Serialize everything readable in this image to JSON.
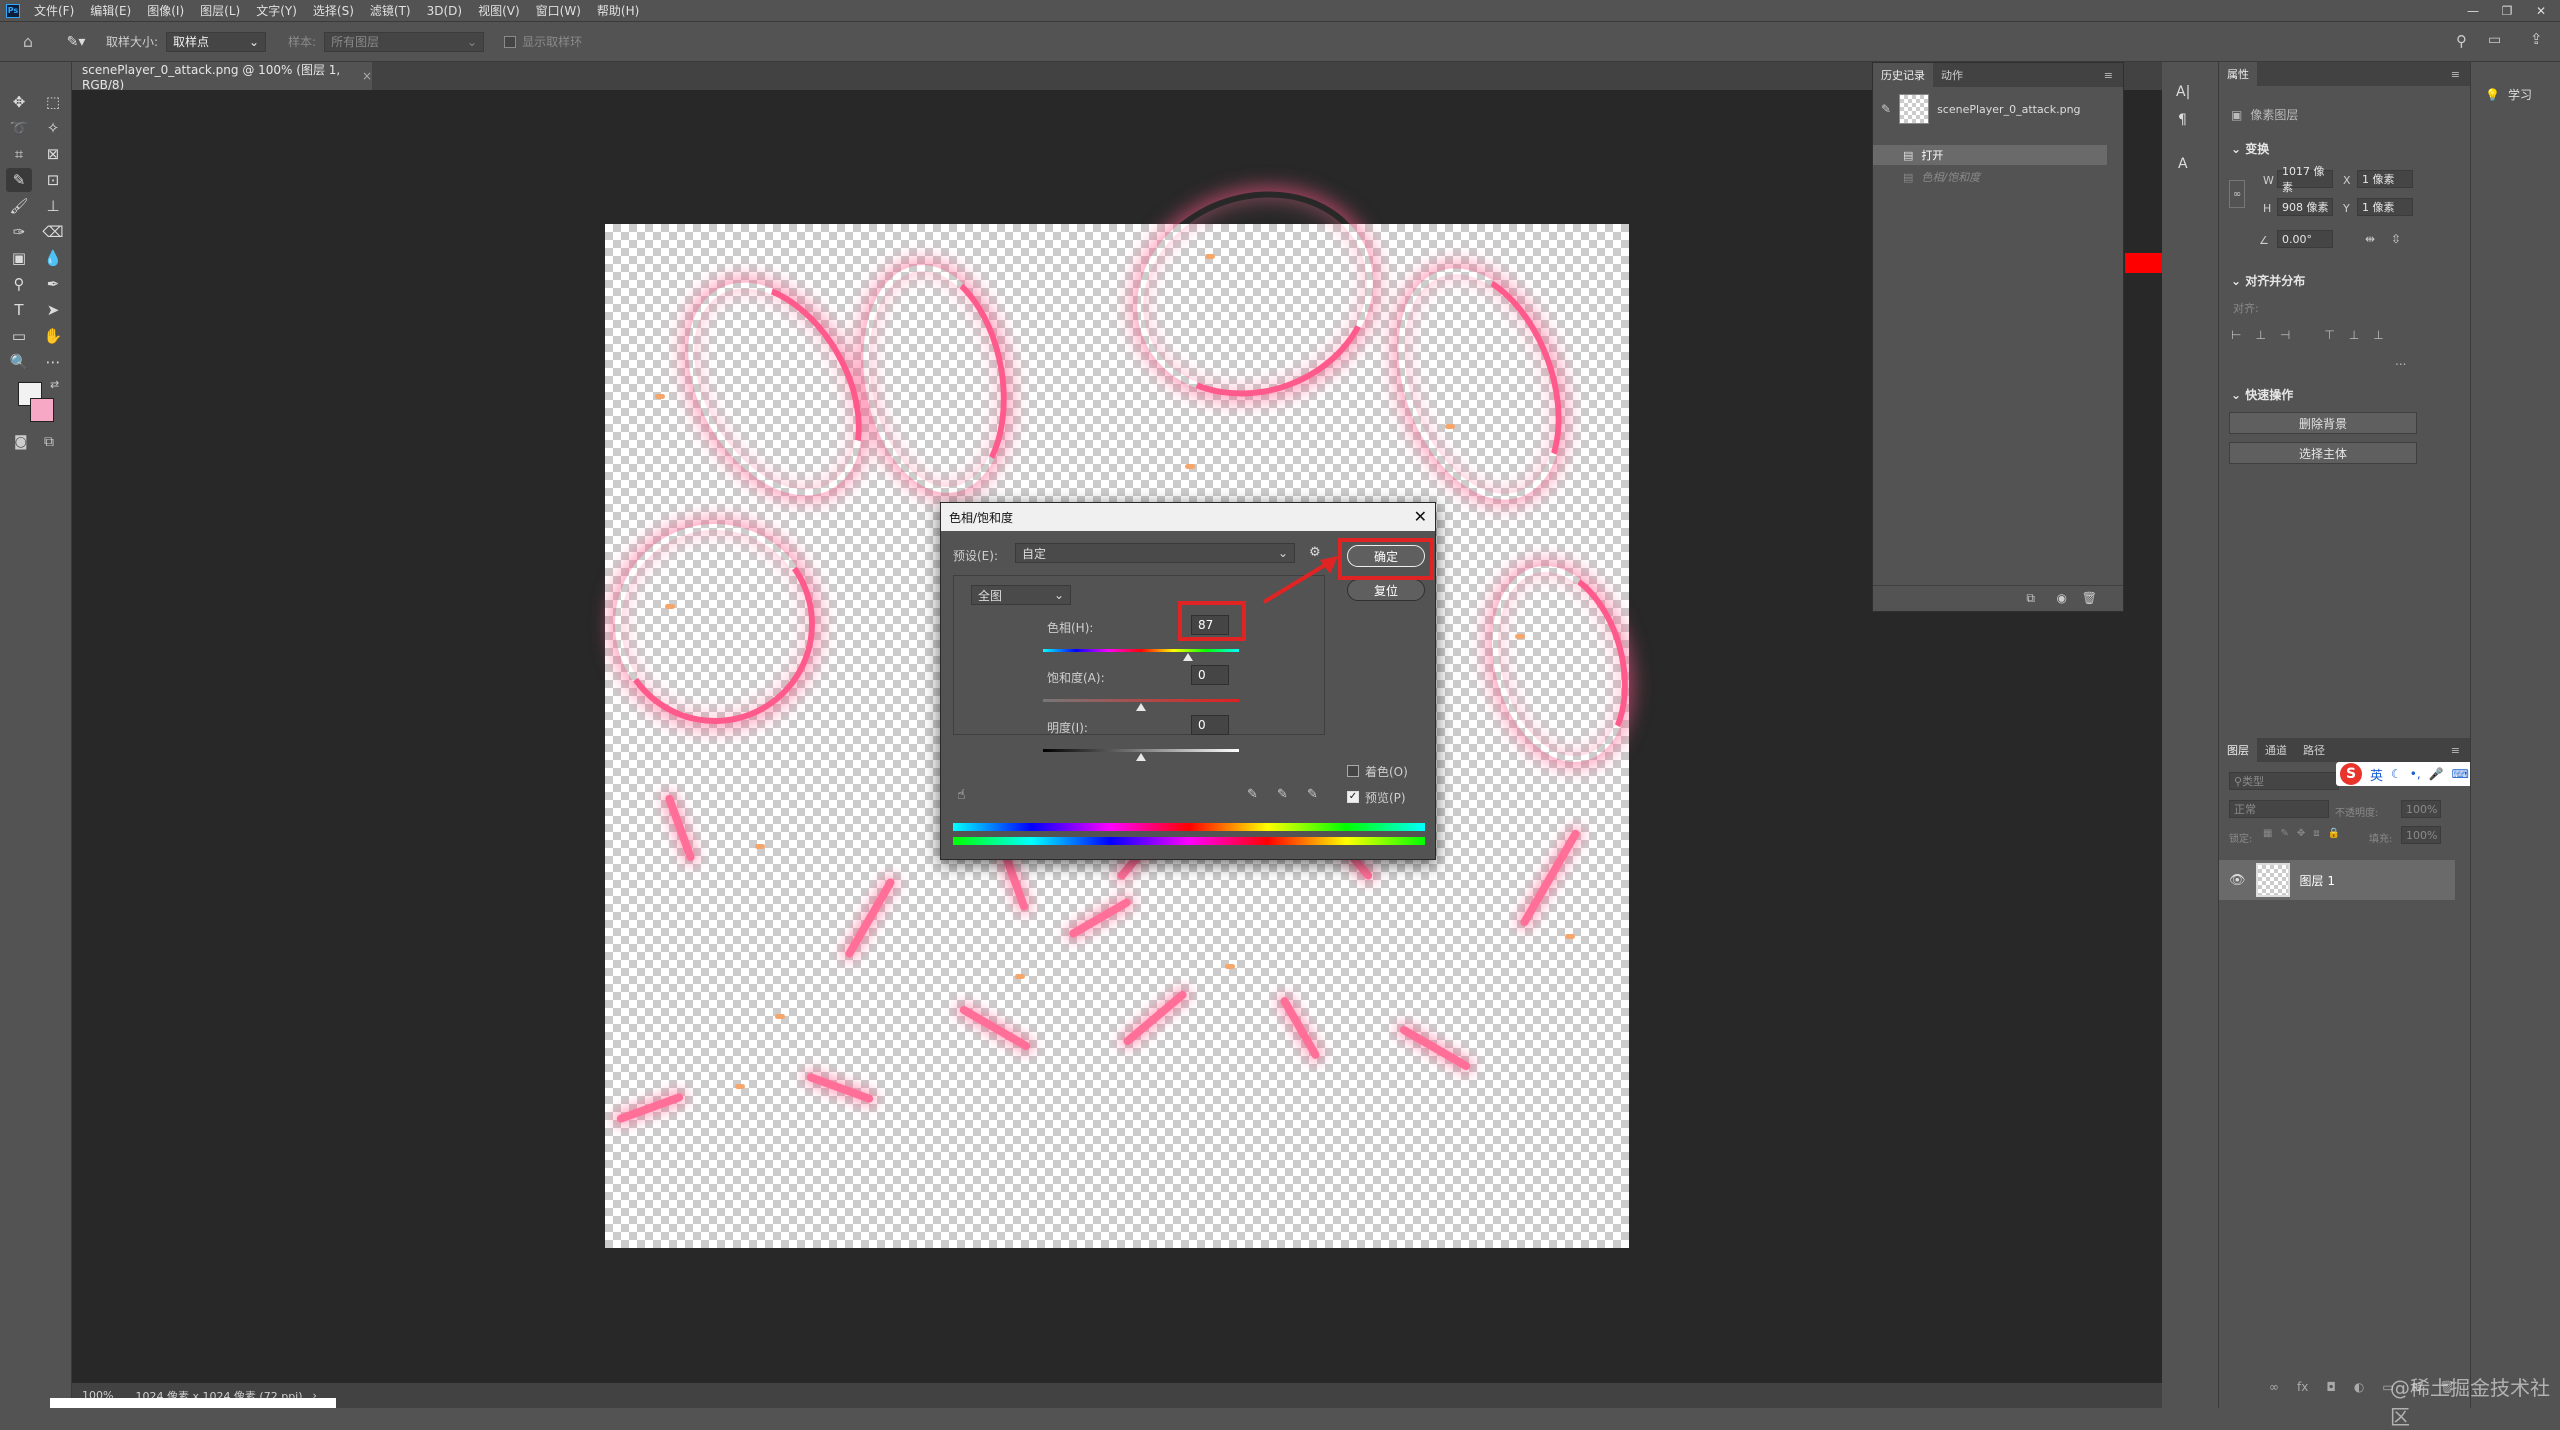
{
  "menubar": {
    "logo": "Ps",
    "items": [
      "文件(F)",
      "编辑(E)",
      "图像(I)",
      "图层(L)",
      "文字(Y)",
      "选择(S)",
      "滤镜(T)",
      "3D(D)",
      "视图(V)",
      "窗口(W)",
      "帮助(H)"
    ]
  },
  "options": {
    "sample_size_label": "取样大小:",
    "sample_size_value": "取样点",
    "sample_label": "样本:",
    "sample_value": "所有图层",
    "show_ring_label": "显示取样环"
  },
  "document": {
    "tab_title": "scenePlayer_0_attack.png @ 100% (图层 1, RGB/8)",
    "tab_close": "×"
  },
  "status": {
    "zoom": "100%",
    "doc_info": "1024 像素 x 1024 像素 (72 ppi)",
    "arrow": "›"
  },
  "history_panel": {
    "tabs": [
      "历史记录",
      "动作"
    ],
    "snapshot_name": "scenePlayer_0_attack.png",
    "states": [
      "打开",
      "色相/饱和度"
    ]
  },
  "properties_panel": {
    "tab": "属性",
    "layer_type": "像素图层",
    "transform_title": "变换",
    "w_label": "W",
    "w_value": "1017 像素",
    "h_label": "H",
    "h_value": "908 像素",
    "x_label": "X",
    "x_value": "1 像素",
    "y_label": "Y",
    "y_value": "1 像素",
    "angle_value": "0.00°",
    "align_title": "对齐并分布",
    "align_sub": "对齐:",
    "more": "...",
    "quick_title": "快速操作",
    "remove_bg": "删除背景",
    "select_subject": "选择主体"
  },
  "layers_panel": {
    "tabs": [
      "图层",
      "通道",
      "路径"
    ],
    "search_placeholder": "类型",
    "blend_mode": "正常",
    "opacity_label": "不透明度:",
    "opacity_value": "100%",
    "lock_label": "锁定:",
    "fill_label": "填充:",
    "fill_value": "100%",
    "layer_name": "图层 1"
  },
  "learn_panel": {
    "label": "学习"
  },
  "ime_bar": {
    "lang": "英"
  },
  "dialog": {
    "title": "色相/饱和度",
    "preset_label": "预设(E):",
    "preset_value": "自定",
    "channel": "全图",
    "hue_label": "色相(H):",
    "hue_value": "87",
    "saturation_label": "饱和度(A):",
    "saturation_value": "0",
    "lightness_label": "明度(I):",
    "lightness_value": "0",
    "ok": "确定",
    "reset": "复位",
    "colorize_label": "着色(O)",
    "preview_label": "预览(P)",
    "colorize_checked": false,
    "preview_checked": true,
    "hue_range": [
      -180,
      180
    ],
    "sat_range": [
      -100,
      100
    ],
    "light_range": [
      -100,
      100
    ]
  },
  "watermark": "@稀土掘金技术社区",
  "colors": {
    "highlight_red": "#e02424",
    "foreground_swatch": "#f2f2f2",
    "background_swatch": "#f7a8c4",
    "accent_red": "#ff0000"
  }
}
